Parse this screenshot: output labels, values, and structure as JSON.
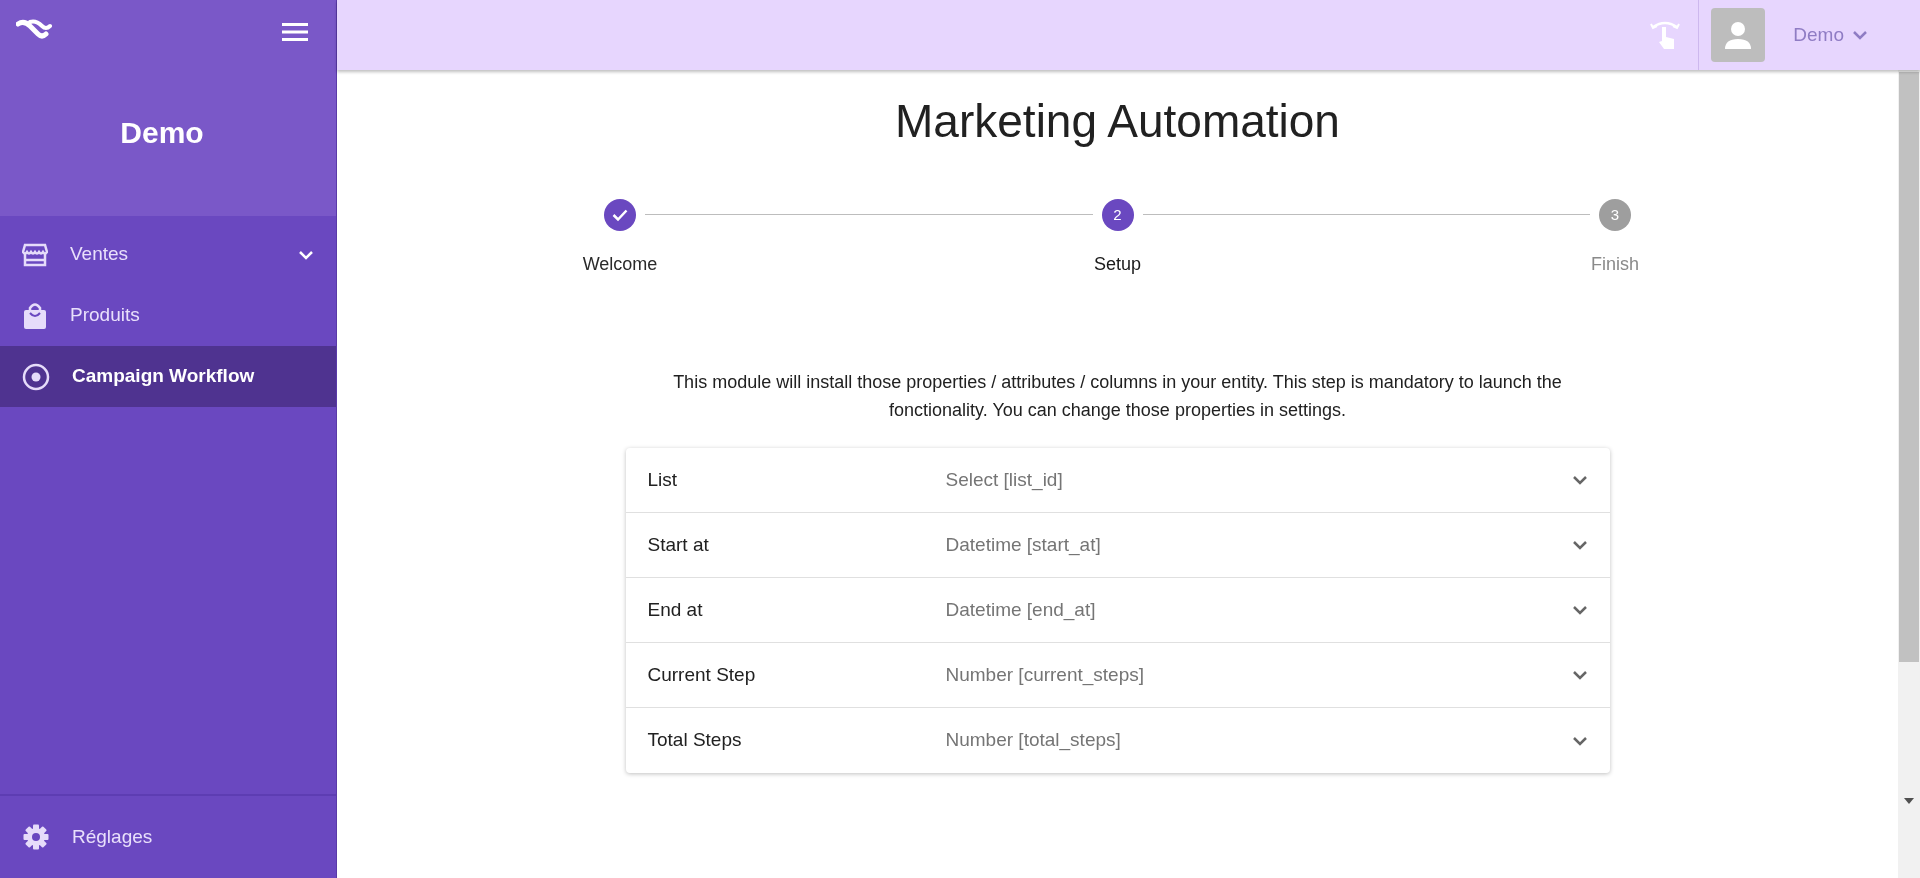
{
  "sidebar": {
    "brand": "Demo",
    "items": [
      {
        "label": "Ventes",
        "expandable": true,
        "selected": false
      },
      {
        "label": "Produits",
        "expandable": false,
        "selected": false
      },
      {
        "label": "Campaign Workflow",
        "expandable": false,
        "selected": true
      }
    ],
    "footer_item": {
      "label": "Réglages"
    }
  },
  "topbar": {
    "user": "Demo"
  },
  "page": {
    "title": "Marketing Automation",
    "steps": [
      {
        "label": "Welcome",
        "completed": true,
        "selected": false
      },
      {
        "label": "Setup",
        "number": "2",
        "completed": false,
        "selected": true
      },
      {
        "label": "Finish",
        "number": "3",
        "completed": false,
        "selected": false
      }
    ],
    "description": "This module will install those properties / attributes / columns in your entity. This step is mandatory to launch the fonctionality. You can change those properties in settings.",
    "fields": [
      {
        "label": "List",
        "placeholder": "Select [list_id]"
      },
      {
        "label": "Start at",
        "placeholder": "Datetime [start_at]"
      },
      {
        "label": "End at",
        "placeholder": "Datetime [end_at]"
      },
      {
        "label": "Current Step",
        "placeholder": "Number [current_steps]"
      },
      {
        "label": "Total Steps",
        "placeholder": "Number [total_steps]"
      }
    ]
  }
}
